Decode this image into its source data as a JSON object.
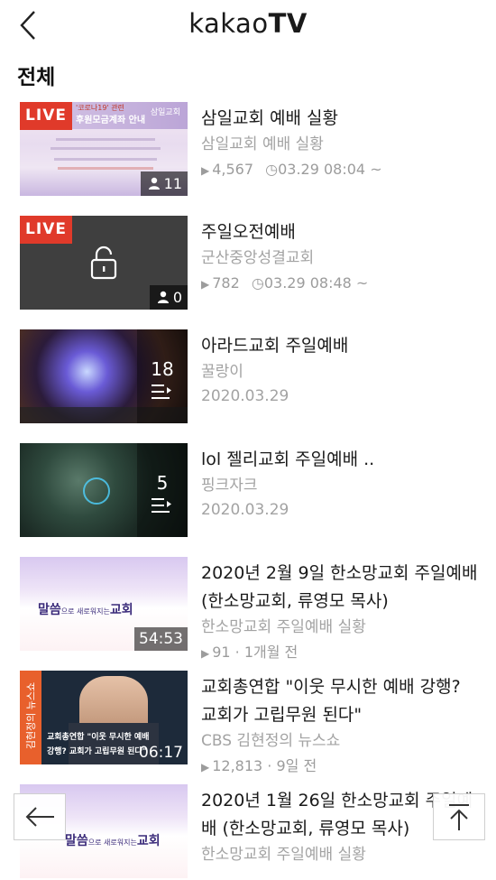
{
  "header": {
    "logo_thin": "kakao",
    "logo_bold": "TV"
  },
  "section": {
    "title": "전체"
  },
  "items": [
    {
      "title": "삼일교회 예배 실황",
      "channel": "삼일교회 예배 실황",
      "views": "4,567",
      "time": "03.29 08:04 ~",
      "live": "LIVE",
      "viewers": "11"
    },
    {
      "title": "주일오전예배",
      "channel": "군산중앙성결교회",
      "views": "782",
      "time": "03.29 08:48 ~",
      "live": "LIVE",
      "viewers": "0"
    },
    {
      "title": "아라드교회 주일예배",
      "channel": "꿀랑이",
      "date": "2020.03.29",
      "playlist_count": "18"
    },
    {
      "title": "lol 젤리교회 주일예배 ..",
      "channel": "핑크자크",
      "date": "2020.03.29",
      "playlist_count": "5"
    },
    {
      "title": "2020년 2월 9일 한소망교회 주일예배 (한소망교회, 류영모 목사)",
      "channel": "한소망교회 주일예배 실황",
      "stats": "91 · 1개월 전",
      "duration": "54:53"
    },
    {
      "title": "교회총연합 \"이웃 무시한 예배 강행? 교회가 고립무원 된다\"",
      "channel": "CBS 김현정의 뉴스쇼",
      "stats": "12,813 · 9일 전",
      "duration": "06:17"
    },
    {
      "title": "2020년 1월 26일 한소망교회 주일예배 (한소망교회, 류영모 목사)",
      "channel": "한소망교회 주일예배 실황"
    }
  ],
  "thumbs": {
    "notice_line1": "'코로나19' 관련",
    "notice_line2": "후원모금계좌 안내",
    "notice_church": "삼일교회",
    "malsseum_main": "말씀",
    "malsseum_small": "으로 새로워지는",
    "malsseum_end": "교회",
    "news_side": "김현정의 뉴스쇼",
    "news_caption": "교회총연합 \"이웃 무시한 예배 강행? 교회가 고립무원 된다\""
  },
  "colors": {
    "live": "#e03a2a",
    "muted_text": "#a3a3a3"
  }
}
